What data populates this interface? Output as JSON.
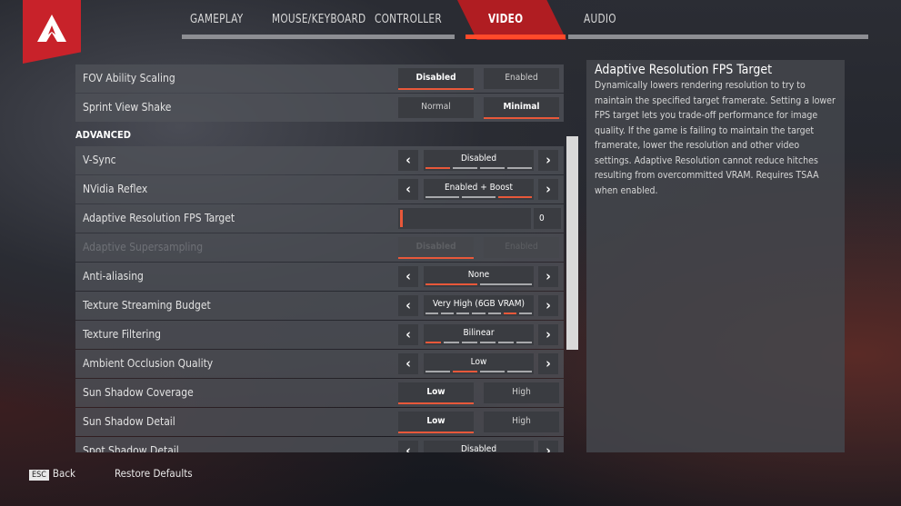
{
  "tabs": [
    {
      "label": "GAMEPLAY"
    },
    {
      "label": "MOUSE/KEYBOARD"
    },
    {
      "label": "CONTROLLER"
    },
    {
      "label": "VIDEO",
      "active": true
    },
    {
      "label": "AUDIO"
    }
  ],
  "accent": "#e8583a",
  "brand": "#c8222a",
  "rows_top": [
    {
      "label": "FOV Ability Scaling",
      "options": [
        "Disabled",
        "Enabled"
      ],
      "selected": 0
    },
    {
      "label": "Sprint View Shake",
      "options": [
        "Normal",
        "Minimal"
      ],
      "selected": 1
    }
  ],
  "section": "ADVANCED",
  "rows": [
    {
      "label": "V-Sync",
      "type": "stepper",
      "value": "Disabled",
      "segments": 4,
      "selected": 0
    },
    {
      "label": "NVidia Reflex",
      "type": "stepper",
      "value": "Enabled + Boost",
      "segments": 3,
      "selected": 2
    },
    {
      "label": "Adaptive Resolution FPS Target",
      "type": "slider",
      "value": "0"
    },
    {
      "label": "Adaptive Supersampling",
      "type": "toggle",
      "options": [
        "Disabled",
        "Enabled"
      ],
      "selected": 0,
      "disabled": true
    },
    {
      "label": "Anti-aliasing",
      "type": "stepper",
      "value": "None",
      "segments": 2,
      "selected": 0
    },
    {
      "label": "Texture Streaming Budget",
      "type": "stepper",
      "value": "Very High (6GB VRAM)",
      "segments": 7,
      "selected": 5
    },
    {
      "label": "Texture Filtering",
      "type": "stepper",
      "value": "Bilinear",
      "segments": 6,
      "selected": 0
    },
    {
      "label": "Ambient Occlusion Quality",
      "type": "stepper",
      "value": "Low",
      "segments": 4,
      "selected": 1
    },
    {
      "label": "Sun Shadow Coverage",
      "type": "toggle",
      "options": [
        "Low",
        "High"
      ],
      "selected": 0
    },
    {
      "label": "Sun Shadow Detail",
      "type": "toggle",
      "options": [
        "Low",
        "High"
      ],
      "selected": 0
    },
    {
      "label": "Spot Shadow Detail",
      "type": "stepper",
      "value": "Disabled",
      "segments": 4,
      "selected": 0
    }
  ],
  "description": {
    "title": "Adaptive Resolution FPS Target",
    "text": "Dynamically lowers rendering resolution to try to maintain the specified target framerate. Setting a lower FPS target lets you trade-off performance for image quality. If the game is failing to maintain the target framerate, lower the resolution and other video settings. Adaptive Resolution cannot reduce hitches resulting from overcommitted VRAM. Requires TSAA when enabled."
  },
  "footer": {
    "esc_key": "ESC",
    "back": "Back",
    "restore": "Restore Defaults"
  }
}
